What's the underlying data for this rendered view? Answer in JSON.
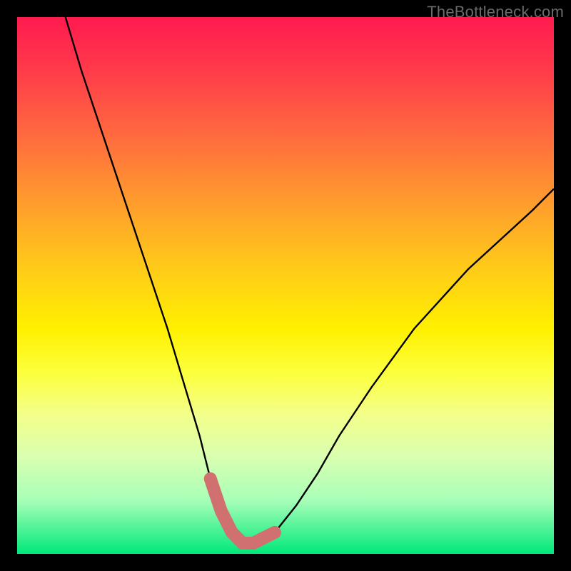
{
  "watermark": "TheBottleneck.com",
  "chart_data": {
    "type": "line",
    "title": "",
    "xlabel": "",
    "ylabel": "",
    "ylim": [
      0,
      100
    ],
    "xlim": [
      0,
      100
    ],
    "series": [
      {
        "name": "curve",
        "x": [
          9,
          12,
          16,
          20,
          24,
          28,
          31,
          34,
          36,
          38,
          40,
          42,
          44,
          48,
          52,
          56,
          60,
          66,
          74,
          84,
          96,
          100
        ],
        "values": [
          100,
          90,
          78,
          66,
          54,
          42,
          32,
          22,
          14,
          8,
          4,
          2,
          2,
          4,
          9,
          15,
          22,
          31,
          42,
          53,
          64,
          68
        ]
      },
      {
        "name": "highlight",
        "x": [
          36,
          38,
          40,
          42,
          44,
          46,
          48
        ],
        "values": [
          14,
          8,
          4,
          2,
          2,
          3,
          4
        ]
      }
    ],
    "colors": {
      "curve": "#000000",
      "highlight": "#d07070"
    }
  }
}
